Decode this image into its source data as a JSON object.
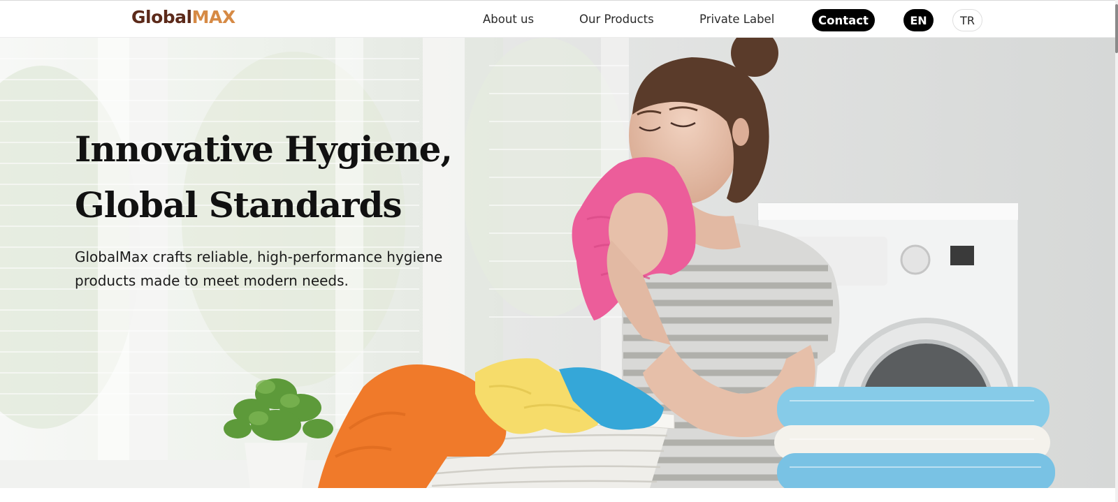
{
  "brand": {
    "logo_part1": "Global",
    "logo_part2": "MAX"
  },
  "nav": {
    "about": "About us",
    "products": "Our Products",
    "private_label": "Private Label",
    "contact": "Contact"
  },
  "languages": {
    "en": "EN",
    "tr": "TR",
    "selected": "EN"
  },
  "hero": {
    "title_line1": "Innovative Hygiene,",
    "title_line2": "Global Standards",
    "subtitle_line1": "GlobalMax crafts reliable, high-performance hygiene",
    "subtitle_line2": "products made to meet modern needs."
  },
  "colors": {
    "logo_dark": "#5c2a1a",
    "logo_accent": "#d68a45",
    "button_bg": "#000000",
    "towel_pink": "#ec5d9a",
    "towel_orange": "#f07a2a",
    "towel_yellow": "#f6dc6a",
    "towel_blue": "#35a7d8",
    "towel_light_blue": "#86cbe8"
  }
}
